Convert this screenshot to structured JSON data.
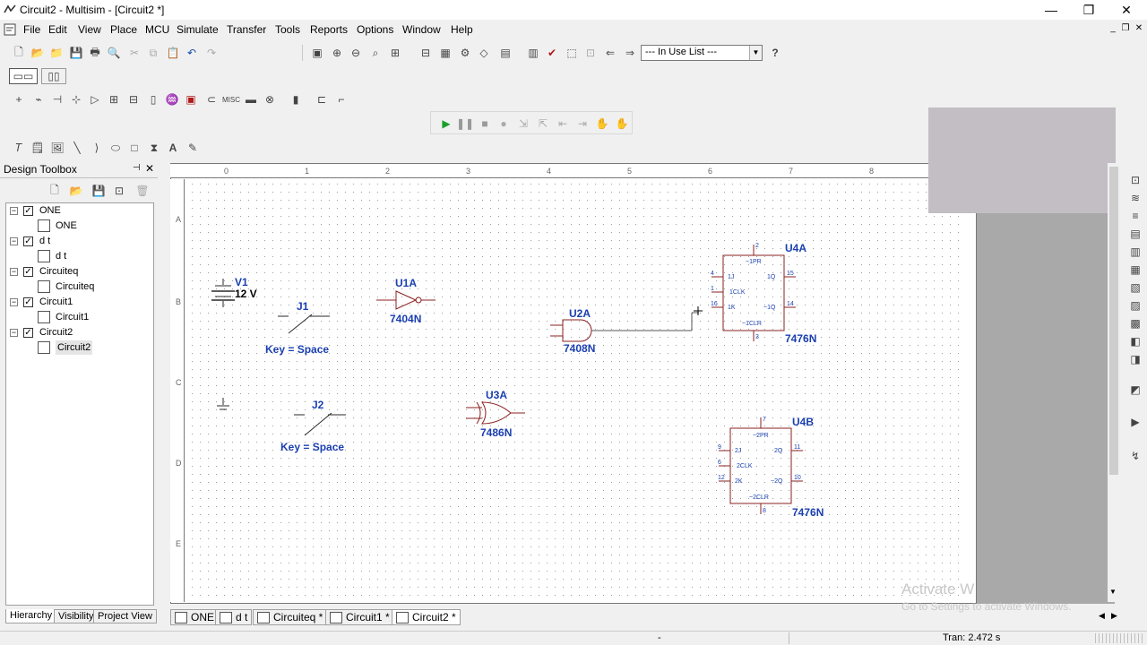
{
  "window": {
    "title": "Circuit2 - Multisim - [Circuit2 *]",
    "minimize": "—",
    "restore": "❐",
    "close": "✕"
  },
  "menus": [
    "File",
    "Edit",
    "View",
    "Place",
    "MCU",
    "Simulate",
    "Transfer",
    "Tools",
    "Reports",
    "Options",
    "Window",
    "Help"
  ],
  "toolbar": {
    "in_use_list": "--- In Use List ---",
    "help": "?"
  },
  "toolbox": {
    "title": "Design Toolbox",
    "tree": [
      {
        "label": "ONE",
        "child": "ONE"
      },
      {
        "label": "d t",
        "child": "d t"
      },
      {
        "label": "Circuiteq",
        "child": "Circuiteq"
      },
      {
        "label": "Circuit1",
        "child": "Circuit1"
      },
      {
        "label": "Circuit2",
        "child": "Circuit2"
      }
    ],
    "tabs": [
      "Hierarchy",
      "Visibility",
      "Project View"
    ]
  },
  "ruler": {
    "h": [
      "0",
      "1",
      "2",
      "3",
      "4",
      "5",
      "6",
      "7",
      "8"
    ],
    "v": [
      "A",
      "B",
      "C",
      "D",
      "E"
    ]
  },
  "schematic": {
    "v1": {
      "name": "V1",
      "value": "12 V"
    },
    "j1": {
      "name": "J1",
      "key": "Key = Space"
    },
    "j2": {
      "name": "J2",
      "key": "Key = Space"
    },
    "u1a": {
      "name": "U1A",
      "part": "7404N"
    },
    "u2a": {
      "name": "U2A",
      "part": "7408N"
    },
    "u3a": {
      "name": "U3A",
      "part": "7486N"
    },
    "u4a": {
      "name": "U4A",
      "part": "7476N",
      "pins": {
        "pr": "~1PR",
        "j": "1J",
        "clk": "1CLK",
        "k": "1K",
        "q": "1Q",
        "qn": "~1Q",
        "clr": "~1CLR"
      },
      "nums": {
        "top": "2",
        "j": "4",
        "clk": "1",
        "k": "16",
        "q": "15",
        "qn": "14",
        "bot": "3"
      }
    },
    "u4b": {
      "name": "U4B",
      "part": "7476N",
      "pins": {
        "pr": "~2PR",
        "j": "2J",
        "clk": "2CLK",
        "k": "2K",
        "q": "2Q",
        "qn": "~2Q",
        "clr": "~2CLR"
      },
      "nums": {
        "top": "7",
        "j": "9",
        "clk": "6",
        "k": "12",
        "q": "11",
        "qn": "10",
        "bot": "8"
      }
    }
  },
  "doc_tabs": [
    "ONE",
    "d t",
    "Circuiteq *",
    "Circuit1 *",
    "Circuit2 *"
  ],
  "status": {
    "sep": "-",
    "tran": "Tran: 2.472 s"
  },
  "watermark": {
    "line1": "Activate W",
    "line2": "Go to Settings to activate Windows."
  }
}
